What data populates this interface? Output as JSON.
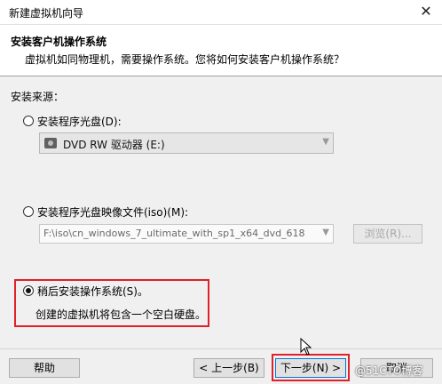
{
  "window": {
    "title": "新建虚拟机向导",
    "close_glyph": "✕"
  },
  "header": {
    "title": "安装客户机操作系统",
    "subtitle": "虚拟机如同物理机，需要操作系统。您将如何安装客户机操作系统？"
  },
  "source": {
    "label": "安装来源：",
    "options": [
      {
        "label": "安装程序光盘(D):",
        "selected": false
      },
      {
        "label": "安装程序光盘映像文件(iso)(M):",
        "selected": false
      },
      {
        "label": "稍后安装操作系统(S)。",
        "selected": true
      }
    ],
    "disc_drive": {
      "value": "DVD RW 驱动器 (E:)",
      "icon": "disc-drive-icon"
    },
    "iso_path": {
      "value": "F:\\iso\\cn_windows_7_ultimate_with_sp1_x64_dvd_618"
    },
    "browse_label": "浏览(R)...",
    "later_note": "创建的虚拟机将包含一个空白硬盘。"
  },
  "footer": {
    "help_label": "帮助",
    "back_label": "< 上一步(B)",
    "next_label": "下一步(N) >",
    "cancel_label": "取消"
  },
  "watermark": "@51CTO博客",
  "colors": {
    "highlight": "#e0202a",
    "focus_border": "#0078d7",
    "dialog_bg": "#f0f0f0"
  }
}
